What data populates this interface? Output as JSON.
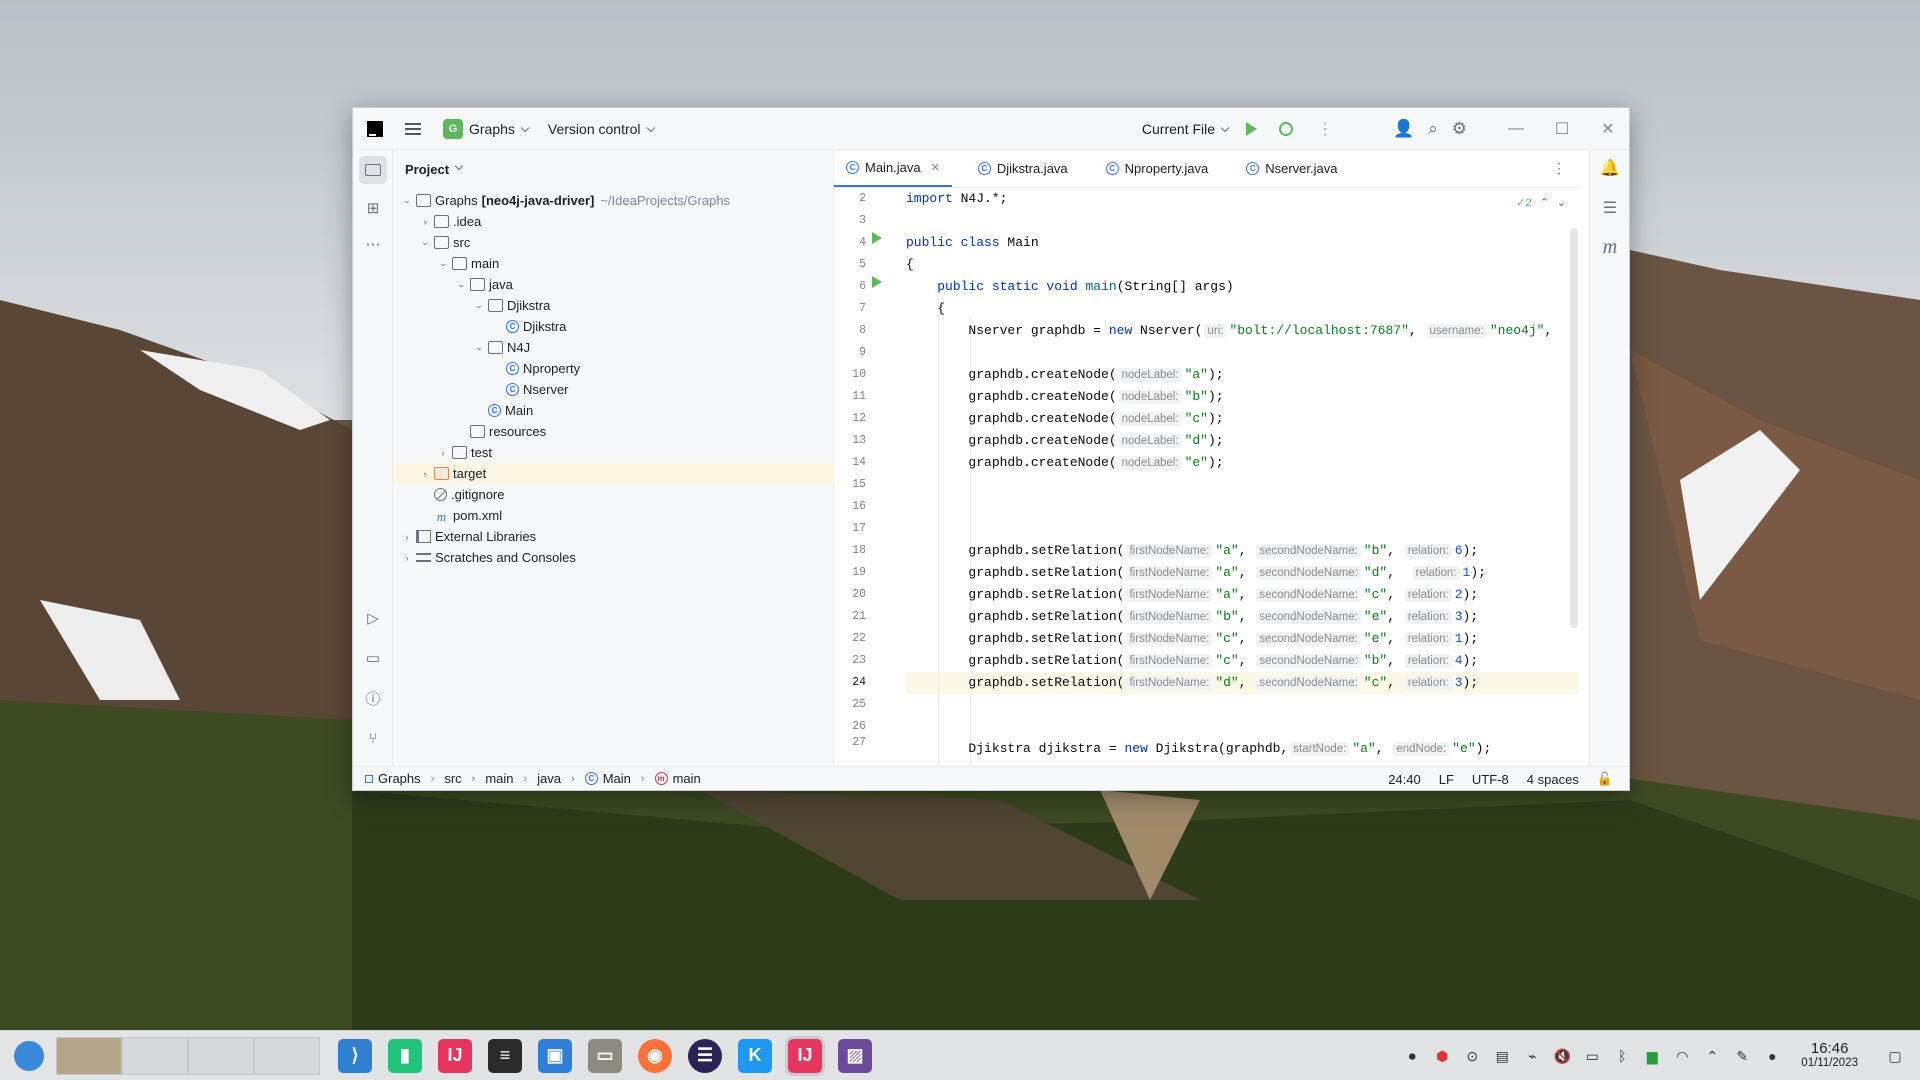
{
  "titlebar": {
    "project_badge": "G",
    "project_name": "Graphs",
    "version_control": "Version control",
    "current_file": "Current File",
    "icons": [
      "menu-icon",
      "run-icon",
      "debug-icon",
      "more-icon",
      "add-user-icon",
      "search-icon",
      "settings-icon",
      "minimize-icon",
      "maximize-icon",
      "close-icon"
    ]
  },
  "project_panel": {
    "title": "Project",
    "tree": [
      {
        "label": "Graphs",
        "bold_suffix": "[neo4j-java-driver]",
        "path": "~/IdeaProjects/Graphs",
        "depth": 0,
        "arrow": "open",
        "icon": "folder"
      },
      {
        "label": ".idea",
        "depth": 1,
        "arrow": "closed",
        "icon": "folder"
      },
      {
        "label": "src",
        "depth": 1,
        "arrow": "open",
        "icon": "folder"
      },
      {
        "label": "main",
        "depth": 2,
        "arrow": "open",
        "icon": "folder"
      },
      {
        "label": "java",
        "depth": 3,
        "arrow": "open",
        "icon": "folder"
      },
      {
        "label": "Djikstra",
        "depth": 4,
        "arrow": "open",
        "icon": "package"
      },
      {
        "label": "Djikstra",
        "depth": 5,
        "arrow": "",
        "icon": "class"
      },
      {
        "label": "N4J",
        "depth": 4,
        "arrow": "open",
        "icon": "package"
      },
      {
        "label": "Nproperty",
        "depth": 5,
        "arrow": "",
        "icon": "class"
      },
      {
        "label": "Nserver",
        "depth": 5,
        "arrow": "",
        "icon": "class"
      },
      {
        "label": "Main",
        "depth": 4,
        "arrow": "",
        "icon": "class"
      },
      {
        "label": "resources",
        "depth": 3,
        "arrow": "",
        "icon": "folder"
      },
      {
        "label": "test",
        "depth": 2,
        "arrow": "closed",
        "icon": "folder"
      },
      {
        "label": "target",
        "depth": 1,
        "arrow": "closed",
        "icon": "folder-orange",
        "selected": true
      },
      {
        "label": ".gitignore",
        "depth": 1,
        "arrow": "",
        "icon": "git"
      },
      {
        "label": "pom.xml",
        "depth": 1,
        "arrow": "",
        "icon": "maven"
      },
      {
        "label": "External Libraries",
        "depth": 0,
        "arrow": "closed",
        "icon": "library"
      },
      {
        "label": "Scratches and Consoles",
        "depth": 0,
        "arrow": "closed",
        "icon": "scratch"
      }
    ]
  },
  "editor": {
    "tabs": [
      {
        "label": "Main.java",
        "active": true
      },
      {
        "label": "Djikstra.java",
        "active": false
      },
      {
        "label": "Nproperty.java",
        "active": false
      },
      {
        "label": "Nserver.java",
        "active": false
      }
    ],
    "inspection_count": "2",
    "current_line": "24"
  },
  "statusbar": {
    "breadcrumb": [
      "Graphs",
      "src",
      "main",
      "java",
      "Main",
      "main"
    ],
    "position": "24:40",
    "line_sep": "LF",
    "encoding": "UTF-8",
    "indent": "4 spaces"
  },
  "taskbar": {
    "clock_time": "16:46",
    "clock_date": "01/11/2023",
    "apps": [
      "vscode",
      "pycharm",
      "intellij",
      "terminal",
      "store",
      "files",
      "firefox",
      "eclipse",
      "kde-apps",
      "intellij-active",
      "screenshot"
    ]
  }
}
